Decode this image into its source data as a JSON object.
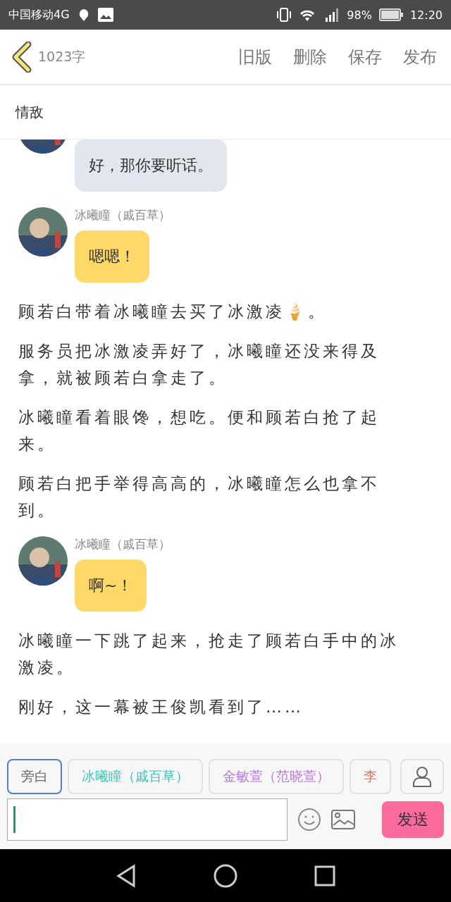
{
  "status_bar": {
    "carrier": "中国移动4G",
    "battery": "98%",
    "time": "12:20"
  },
  "header": {
    "word_count": "1023字",
    "actions": [
      "旧版",
      "删除",
      "保存",
      "发布"
    ]
  },
  "title": "情敌",
  "messages": [
    {
      "kind": "bubble",
      "text": "好，那你要听话。",
      "color": "#e1e6ef"
    },
    {
      "kind": "bubble",
      "speaker": "冰曦瞳（戚百草）",
      "text": "嗯嗯！",
      "color": "#fdd96a"
    },
    {
      "kind": "paragraph",
      "text": "顾若白带着冰曦瞳去买了冰激凌🍦。"
    },
    {
      "kind": "paragraph",
      "text": "服务员把冰激凌弄好了，冰曦瞳还没来得及拿，就被顾若白拿走了。"
    },
    {
      "kind": "paragraph",
      "text": "冰曦瞳看着眼馋，想吃。便和顾若白抢了起来。"
    },
    {
      "kind": "paragraph",
      "text": "顾若白把手举得高高的，冰曦瞳怎么也拿不到。"
    },
    {
      "kind": "bubble",
      "speaker": "冰曦瞳（戚百草）",
      "text": "啊~！",
      "color": "#fdd96a"
    },
    {
      "kind": "paragraph",
      "text": "冰曦瞳一下跳了起来，抢走了顾若白手中的冰激凌。"
    },
    {
      "kind": "paragraph",
      "text": "刚好，这一幕被王俊凯看到了……"
    }
  ],
  "characters": [
    {
      "label": "旁白",
      "selected": true,
      "color": "#666666"
    },
    {
      "label": "冰曦瞳（戚百草）",
      "selected": false,
      "color": "#3cc4b4"
    },
    {
      "label": "金敏萱（范晓萱）",
      "selected": false,
      "color": "#b57ad8"
    },
    {
      "label": "李",
      "selected": false,
      "color": "#e86a5a"
    }
  ],
  "composer": {
    "send": "发送"
  }
}
